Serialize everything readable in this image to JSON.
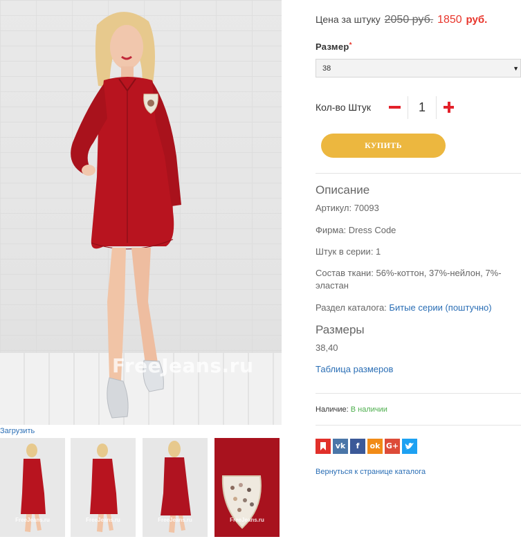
{
  "gallery": {
    "watermark": "FreeJeans.ru",
    "upload_label": "Загрузить",
    "thumbs": [
      {
        "watermark": "FreeJeans.ru"
      },
      {
        "watermark": "FreeJeans.ru"
      },
      {
        "watermark": "FreeJeans.ru"
      },
      {
        "watermark": "FreeJeans.ru"
      }
    ]
  },
  "price": {
    "label": "Цена за штуку",
    "old": "2050 руб.",
    "new": "1850",
    "currency": "руб."
  },
  "size": {
    "label": "Размер",
    "required_mark": "*",
    "selected": "38"
  },
  "quantity": {
    "label": "Кол-во Штук",
    "value": "1"
  },
  "buy_button": "КУПИТЬ",
  "description": {
    "title": "Описание",
    "article": "Артикул: 70093",
    "brand": "Фирма: Dress Code",
    "series_count": "Штук в серии: 1",
    "fabric": "Состав ткани: 56%-коттон, 37%-нейлон, 7%-эластан",
    "catalog_label": "Раздел каталога:",
    "catalog_link": "Битые серии (поштучно)"
  },
  "sizes": {
    "title": "Размеры",
    "values": "38,40",
    "table_link": "Таблица размеров"
  },
  "availability": {
    "label": "Наличие:",
    "status": "В наличии"
  },
  "share": [
    {
      "icon": "bookmark-icon",
      "color": "#e1302a",
      "glyph": "❚"
    },
    {
      "icon": "vk-icon",
      "color": "#4a76a8",
      "glyph": "vk"
    },
    {
      "icon": "facebook-icon",
      "color": "#3b5998",
      "glyph": "f"
    },
    {
      "icon": "odnoklassniki-icon",
      "color": "#f18b17",
      "glyph": "ok"
    },
    {
      "icon": "google-plus-icon",
      "color": "#dd4b39",
      "glyph": "G+"
    },
    {
      "icon": "twitter-icon",
      "color": "#1da1f2",
      "glyph": "t"
    }
  ],
  "back_link": "Вернуться к странице каталога",
  "colors": {
    "accent_red": "#e8352b",
    "buy_button": "#ecb73f",
    "link_blue": "#2a6eb5",
    "in_stock_green": "#4cae4c",
    "dress_red": "#b8141f"
  }
}
